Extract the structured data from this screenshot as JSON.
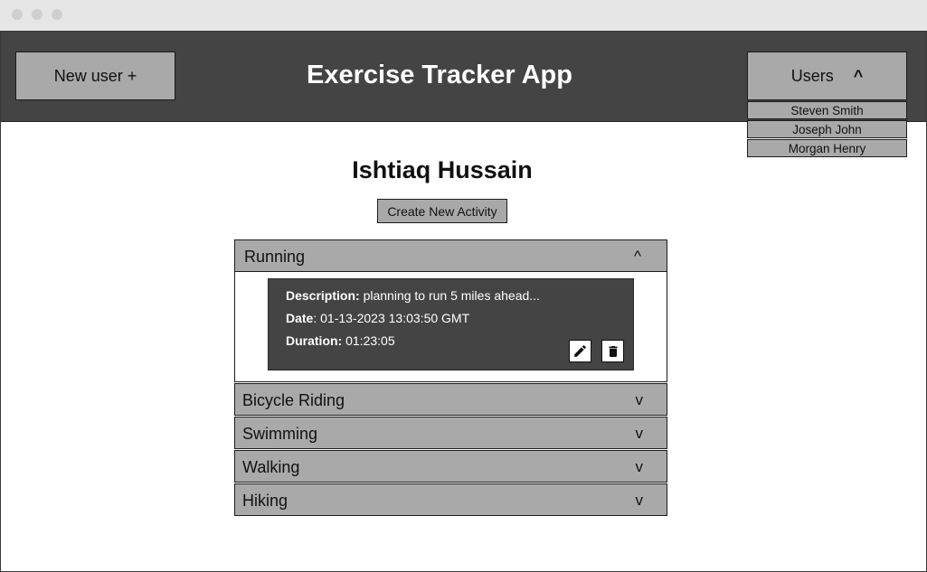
{
  "header": {
    "title": "Exercise Tracker App",
    "new_user_label": "New user +",
    "users_label": "Users",
    "users_chevron": "^"
  },
  "users_menu": {
    "items": [
      "Steven Smith",
      "Joseph John",
      "Morgan Henry"
    ]
  },
  "main": {
    "user_name": "Ishtiaq Hussain",
    "create_activity_label": "Create New Activity"
  },
  "activities": [
    {
      "name": "Running",
      "chevron": "^",
      "expanded": true,
      "details": {
        "description_label": "Description:",
        "description": "planning to run 5 miles ahead...",
        "date_label": "Date",
        "date": ": 01-13-2023 13:03:50 GMT",
        "duration_label": "Duration:",
        "duration": "01:23:05"
      }
    },
    {
      "name": "Bicycle Riding",
      "chevron": "v"
    },
    {
      "name": "Swimming",
      "chevron": "v"
    },
    {
      "name": "Walking",
      "chevron": "v"
    },
    {
      "name": "Hiking",
      "chevron": "v"
    }
  ],
  "icons": {
    "edit": "edit-icon",
    "delete": "trash-icon"
  },
  "colors": {
    "header_bg": "#444444",
    "button_bg": "#a9a9a9",
    "card_bg": "#444444"
  }
}
